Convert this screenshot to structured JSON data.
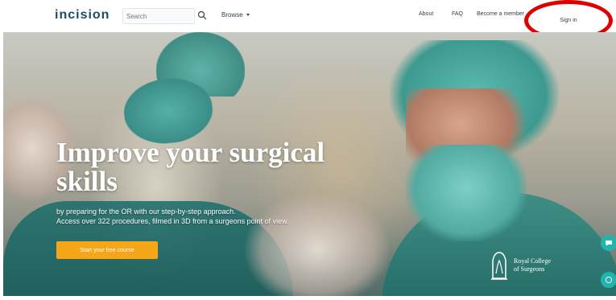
{
  "header": {
    "logo": "incision",
    "search_placeholder": "Search",
    "browse_label": "Browse",
    "nav_links": [
      "About",
      "FAQ",
      "Become a member"
    ],
    "signin_label": "Sign in"
  },
  "hero": {
    "title_line1": "Improve your surgical",
    "title_line2": "skills",
    "sub_line1": "by preparing for the OR with our step-by-step approach.",
    "sub_line2": "Access over 322 procedures, filmed in 3D from a surgeons point of view.",
    "cta_label": "Start your free course",
    "partner_line1": "Royal College",
    "partner_line2": "of Surgeons"
  },
  "colors": {
    "brand": "#1b4e63",
    "cta": "#f5a719",
    "accent": "#21b5ad",
    "annotation_circle": "#e00000"
  },
  "icons": {
    "search": "search-icon",
    "browse": "chevron-down-icon",
    "partner": "crest-icon",
    "chat": "chat-icon"
  }
}
